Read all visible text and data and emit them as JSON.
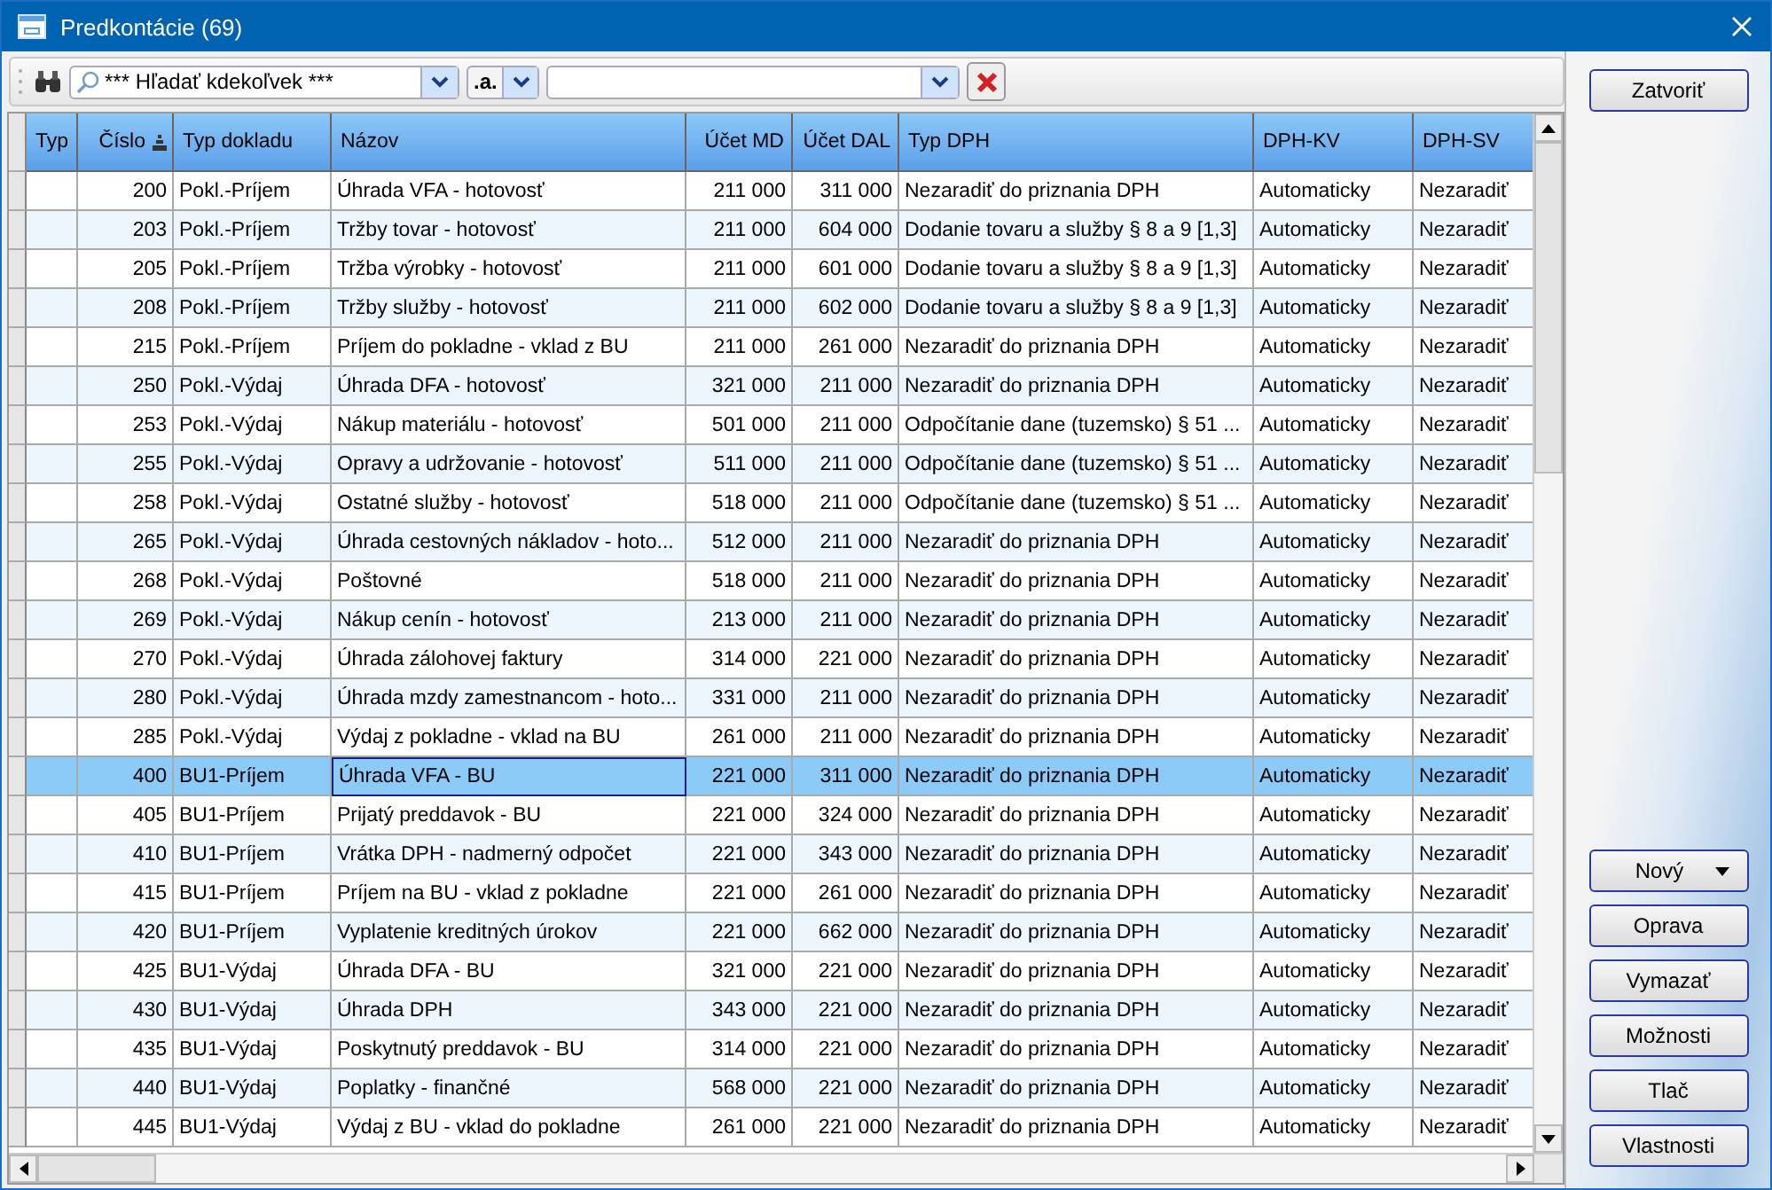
{
  "window": {
    "title": "Predkontácie (69)"
  },
  "toolbar": {
    "search_scope": "*** Hľadať kdekoľvek ***",
    "match_mode": ".a."
  },
  "table": {
    "columns": [
      {
        "label": "Typ",
        "sorted": false
      },
      {
        "label": "Číslo",
        "sorted": true
      },
      {
        "label": "Typ dokladu",
        "sorted": false
      },
      {
        "label": "Názov",
        "sorted": false
      },
      {
        "label": "Účet MD",
        "sorted": false
      },
      {
        "label": "Účet DAL",
        "sorted": false
      },
      {
        "label": "Typ DPH",
        "sorted": false
      },
      {
        "label": "DPH-KV",
        "sorted": false
      },
      {
        "label": "DPH-SV",
        "sorted": false
      }
    ],
    "rows": [
      {
        "selected": false,
        "cells": [
          "",
          "200",
          "Pokl.-Príjem",
          "Úhrada VFA - hotovosť",
          "211 000",
          "311 000",
          "Nezaradiť do priznania DPH",
          "Automaticky",
          "Nezaradiť"
        ]
      },
      {
        "selected": false,
        "cells": [
          "",
          "203",
          "Pokl.-Príjem",
          "Tržby tovar - hotovosť",
          "211 000",
          "604 000",
          "Dodanie tovaru a služby § 8 a 9 [1,3]",
          "Automaticky",
          "Nezaradiť"
        ]
      },
      {
        "selected": false,
        "cells": [
          "",
          "205",
          "Pokl.-Príjem",
          "Tržba výrobky - hotovosť",
          "211 000",
          "601 000",
          "Dodanie tovaru a služby § 8 a 9 [1,3]",
          "Automaticky",
          "Nezaradiť"
        ]
      },
      {
        "selected": false,
        "cells": [
          "",
          "208",
          "Pokl.-Príjem",
          "Tržby služby - hotovosť",
          "211 000",
          "602 000",
          "Dodanie tovaru a služby § 8 a 9 [1,3]",
          "Automaticky",
          "Nezaradiť"
        ]
      },
      {
        "selected": false,
        "cells": [
          "",
          "215",
          "Pokl.-Príjem",
          "Príjem do pokladne - vklad z BU",
          "211 000",
          "261 000",
          "Nezaradiť do priznania DPH",
          "Automaticky",
          "Nezaradiť"
        ]
      },
      {
        "selected": false,
        "cells": [
          "",
          "250",
          "Pokl.-Výdaj",
          "Úhrada DFA - hotovosť",
          "321 000",
          "211 000",
          "Nezaradiť do priznania DPH",
          "Automaticky",
          "Nezaradiť"
        ]
      },
      {
        "selected": false,
        "cells": [
          "",
          "253",
          "Pokl.-Výdaj",
          "Nákup materiálu - hotovosť",
          "501 000",
          "211 000",
          "Odpočítanie dane (tuzemsko) § 51 ...",
          "Automaticky",
          "Nezaradiť"
        ]
      },
      {
        "selected": false,
        "cells": [
          "",
          "255",
          "Pokl.-Výdaj",
          "Opravy a udržovanie - hotovosť",
          "511 000",
          "211 000",
          "Odpočítanie dane (tuzemsko) § 51 ...",
          "Automaticky",
          "Nezaradiť"
        ]
      },
      {
        "selected": false,
        "cells": [
          "",
          "258",
          "Pokl.-Výdaj",
          "Ostatné služby - hotovosť",
          "518 000",
          "211 000",
          "Odpočítanie dane (tuzemsko) § 51 ...",
          "Automaticky",
          "Nezaradiť"
        ]
      },
      {
        "selected": false,
        "cells": [
          "",
          "265",
          "Pokl.-Výdaj",
          "Úhrada cestovných nákladov - hoto...",
          "512 000",
          "211 000",
          "Nezaradiť do priznania DPH",
          "Automaticky",
          "Nezaradiť"
        ]
      },
      {
        "selected": false,
        "cells": [
          "",
          "268",
          "Pokl.-Výdaj",
          "Poštovné",
          "518 000",
          "211 000",
          "Nezaradiť do priznania DPH",
          "Automaticky",
          "Nezaradiť"
        ]
      },
      {
        "selected": false,
        "cells": [
          "",
          "269",
          "Pokl.-Výdaj",
          "Nákup cenín - hotovosť",
          "213 000",
          "211 000",
          "Nezaradiť do priznania DPH",
          "Automaticky",
          "Nezaradiť"
        ]
      },
      {
        "selected": false,
        "cells": [
          "",
          "270",
          "Pokl.-Výdaj",
          "Úhrada zálohovej faktury",
          "314 000",
          "221 000",
          "Nezaradiť do priznania DPH",
          "Automaticky",
          "Nezaradiť"
        ]
      },
      {
        "selected": false,
        "cells": [
          "",
          "280",
          "Pokl.-Výdaj",
          "Úhrada mzdy zamestnancom - hoto...",
          "331 000",
          "211 000",
          "Nezaradiť do priznania DPH",
          "Automaticky",
          "Nezaradiť"
        ]
      },
      {
        "selected": false,
        "cells": [
          "",
          "285",
          "Pokl.-Výdaj",
          "Výdaj z pokladne - vklad na BU",
          "261 000",
          "211 000",
          "Nezaradiť do priznania DPH",
          "Automaticky",
          "Nezaradiť"
        ]
      },
      {
        "selected": true,
        "cells": [
          "",
          "400",
          "BU1-Príjem",
          "Úhrada VFA - BU",
          "221 000",
          "311 000",
          "Nezaradiť do priznania DPH",
          "Automaticky",
          "Nezaradiť"
        ]
      },
      {
        "selected": false,
        "cells": [
          "",
          "405",
          "BU1-Príjem",
          "Prijatý preddavok - BU",
          "221 000",
          "324 000",
          "Nezaradiť do priznania DPH",
          "Automaticky",
          "Nezaradiť"
        ]
      },
      {
        "selected": false,
        "cells": [
          "",
          "410",
          "BU1-Príjem",
          "Vrátka DPH - nadmerný odpočet",
          "221 000",
          "343 000",
          "Nezaradiť do priznania DPH",
          "Automaticky",
          "Nezaradiť"
        ]
      },
      {
        "selected": false,
        "cells": [
          "",
          "415",
          "BU1-Príjem",
          "Príjem na BU - vklad z pokladne",
          "221 000",
          "261 000",
          "Nezaradiť do priznania DPH",
          "Automaticky",
          "Nezaradiť"
        ]
      },
      {
        "selected": false,
        "cells": [
          "",
          "420",
          "BU1-Príjem",
          "Vyplatenie kreditných úrokov",
          "221 000",
          "662 000",
          "Nezaradiť do priznania DPH",
          "Automaticky",
          "Nezaradiť"
        ]
      },
      {
        "selected": false,
        "cells": [
          "",
          "425",
          "BU1-Výdaj",
          "Úhrada DFA - BU",
          "321 000",
          "221 000",
          "Nezaradiť do priznania DPH",
          "Automaticky",
          "Nezaradiť"
        ]
      },
      {
        "selected": false,
        "cells": [
          "",
          "430",
          "BU1-Výdaj",
          "Úhrada DPH",
          "343 000",
          "221 000",
          "Nezaradiť do priznania DPH",
          "Automaticky",
          "Nezaradiť"
        ]
      },
      {
        "selected": false,
        "cells": [
          "",
          "435",
          "BU1-Výdaj",
          "Poskytnutý preddavok - BU",
          "314 000",
          "221 000",
          "Nezaradiť do priznania DPH",
          "Automaticky",
          "Nezaradiť"
        ]
      },
      {
        "selected": false,
        "cells": [
          "",
          "440",
          "BU1-Výdaj",
          "Poplatky - finančné",
          "568 000",
          "221 000",
          "Nezaradiť do priznania DPH",
          "Automaticky",
          "Nezaradiť"
        ]
      },
      {
        "selected": false,
        "cells": [
          "",
          "445",
          "BU1-Výdaj",
          "Výdaj z BU - vklad do pokladne",
          "261 000",
          "221 000",
          "Nezaradiť do priznania DPH",
          "Automaticky",
          "Nezaradiť"
        ]
      }
    ]
  },
  "side_panel": {
    "close_button": "Zatvoriť",
    "actions": [
      {
        "label": "Nový",
        "kind": "dropdown"
      },
      {
        "label": "Oprava",
        "kind": "plain"
      },
      {
        "label": "Vymazať",
        "kind": "plain"
      },
      {
        "label": "Možnosti",
        "kind": "plain"
      },
      {
        "label": "Tlač",
        "kind": "plain"
      },
      {
        "label": "Vlastnosti",
        "kind": "plain"
      }
    ]
  }
}
